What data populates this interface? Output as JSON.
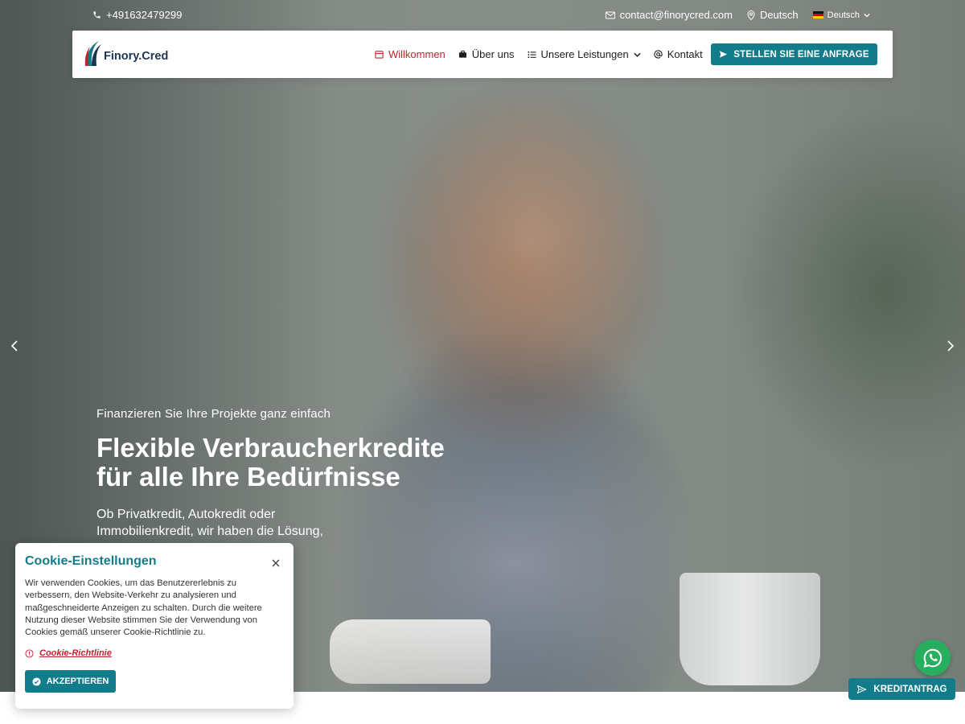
{
  "topbar": {
    "phone": "+491632479299",
    "email": "contact@finorycred.com",
    "location": "Deutsch",
    "language": "Deutsch"
  },
  "brand": {
    "name": "Finory.Cred"
  },
  "nav": {
    "items": [
      {
        "label": "Willkommen",
        "active": true
      },
      {
        "label": "Über uns"
      },
      {
        "label": "Unsere Leistungen"
      },
      {
        "label": "Kontakt"
      }
    ],
    "cta_label": "STELLEN SIE EINE ANFRAGE"
  },
  "hero": {
    "subtitle": "Finanzieren Sie Ihre Projekte ganz einfach",
    "title": "Flexible Verbraucherkredite für alle Ihre Bedürfnisse",
    "description": "Ob Privatkredit, Autokredit oder Immobilienkredit, wir haben die Lösung,"
  },
  "cookie": {
    "title": "Cookie-Einstellungen",
    "text": "Wir verwenden Cookies, um das Benutzererlebnis zu verbessern, den Website-Verkehr zu analysieren und maßgeschneiderte Anzeigen zu schalten. Durch die weitere Nutzung dieser Website stimmen Sie der Verwendung von Cookies gemäß unserer Cookie-Richtlinie zu.",
    "policy_link": "Cookie-Richtlinie",
    "accept_label": "AKZEPTIEREN"
  },
  "floating": {
    "credit_label": "KREDITANTRAG"
  },
  "colors": {
    "primary": "#127c8a",
    "accent_red": "#c0232f",
    "whatsapp": "#27ae5e",
    "brand_navy": "#1d3453"
  },
  "icons": [
    "phone-icon",
    "envelope-icon",
    "location-pin-icon",
    "flag-de-icon",
    "chevron-down-icon",
    "calendar-icon",
    "briefcase-icon",
    "list-icon",
    "at-icon",
    "send-icon",
    "arrow-left-icon",
    "arrow-right-icon",
    "close-icon",
    "info-circle-icon",
    "check-circle-icon",
    "whatsapp-icon"
  ]
}
